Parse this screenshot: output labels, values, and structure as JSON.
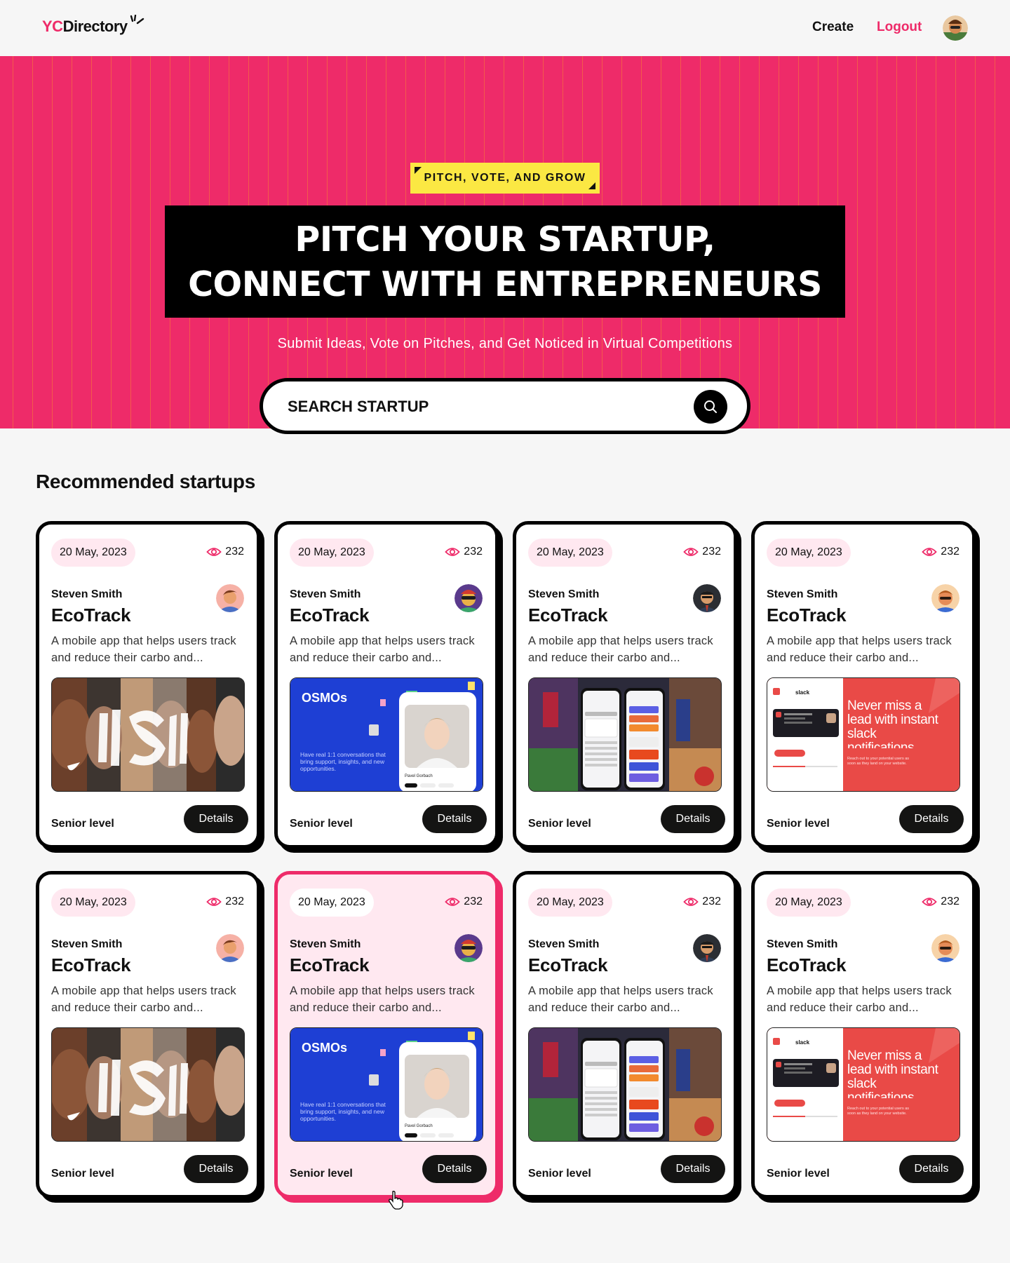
{
  "nav": {
    "logo_prefix": "YC",
    "logo_suffix": "Directory",
    "create": "Create",
    "logout": "Logout"
  },
  "hero": {
    "tag": "PITCH, VOTE, AND GROW",
    "headline_line1": "PITCH YOUR STARTUP,",
    "headline_line2": "CONNECT WITH ENTREPRENEURS",
    "subheading": "Submit Ideas, Vote on Pitches, and Get Noticed in Virtual Competitions",
    "search_placeholder": "SEARCH STARTUP"
  },
  "section": {
    "title": "Recommended startups"
  },
  "colors": {
    "brand_pink": "#ee2b69",
    "tag_yellow": "#fbe843",
    "pink_light": "#ffe8f0",
    "black": "#141413"
  },
  "cards": [
    {
      "date": "20 May, 2023",
      "views": "232",
      "author": "Steven Smith",
      "title": "EcoTrack",
      "description": "A mobile app that helps users track and reduce their carbo and...",
      "category": "Senior level",
      "button": "Details",
      "image": "faces-collage",
      "avatar": "avatar-1"
    },
    {
      "date": "20 May, 2023",
      "views": "232",
      "author": "Steven Smith",
      "title": "EcoTrack",
      "description": "A mobile app that helps users track and reduce their carbo and...",
      "category": "Senior level",
      "button": "Details",
      "image": "osmos-app",
      "avatar": "avatar-2"
    },
    {
      "date": "20 May, 2023",
      "views": "232",
      "author": "Steven Smith",
      "title": "EcoTrack",
      "description": "A mobile app that helps users track and reduce their carbo and...",
      "category": "Senior level",
      "button": "Details",
      "image": "sports-app",
      "avatar": "avatar-3"
    },
    {
      "date": "20 May, 2023",
      "views": "232",
      "author": "Steven Smith",
      "title": "EcoTrack",
      "description": "A mobile app that helps users track and reduce their carbo and...",
      "category": "Senior level",
      "button": "Details",
      "image": "slack-promo",
      "avatar": "avatar-4"
    },
    {
      "date": "20 May, 2023",
      "views": "232",
      "author": "Steven Smith",
      "title": "EcoTrack",
      "description": "A mobile app that helps users track and reduce their carbo and...",
      "category": "Senior level",
      "button": "Details",
      "image": "faces-collage",
      "avatar": "avatar-1"
    },
    {
      "date": "20 May, 2023",
      "views": "232",
      "author": "Steven Smith",
      "title": "EcoTrack",
      "description": "A mobile app that helps users track and reduce their carbo and...",
      "category": "Senior level",
      "button": "Details",
      "image": "osmos-app",
      "avatar": "avatar-2",
      "active": true
    },
    {
      "date": "20 May, 2023",
      "views": "232",
      "author": "Steven Smith",
      "title": "EcoTrack",
      "description": "A mobile app that helps users track and reduce their carbo and...",
      "category": "Senior level",
      "button": "Details",
      "image": "sports-app",
      "avatar": "avatar-3"
    },
    {
      "date": "20 May, 2023",
      "views": "232",
      "author": "Steven Smith",
      "title": "EcoTrack",
      "description": "A mobile app that helps users track and reduce their carbo and...",
      "category": "Senior level",
      "button": "Details",
      "image": "slack-promo",
      "avatar": "avatar-4"
    }
  ],
  "thumb_text": {
    "osmos_logo": "OSMOs",
    "osmos_copy": "Have real 1:1 conversations that bring support, insights, and new opportunities.",
    "osmos_name": "Pavel Gorbach",
    "slack_logo": "slack",
    "slack_headline": "Never miss a lead with instant slack notifications",
    "slack_copy": "Reach out to your potential users as soon as they land on your website."
  }
}
